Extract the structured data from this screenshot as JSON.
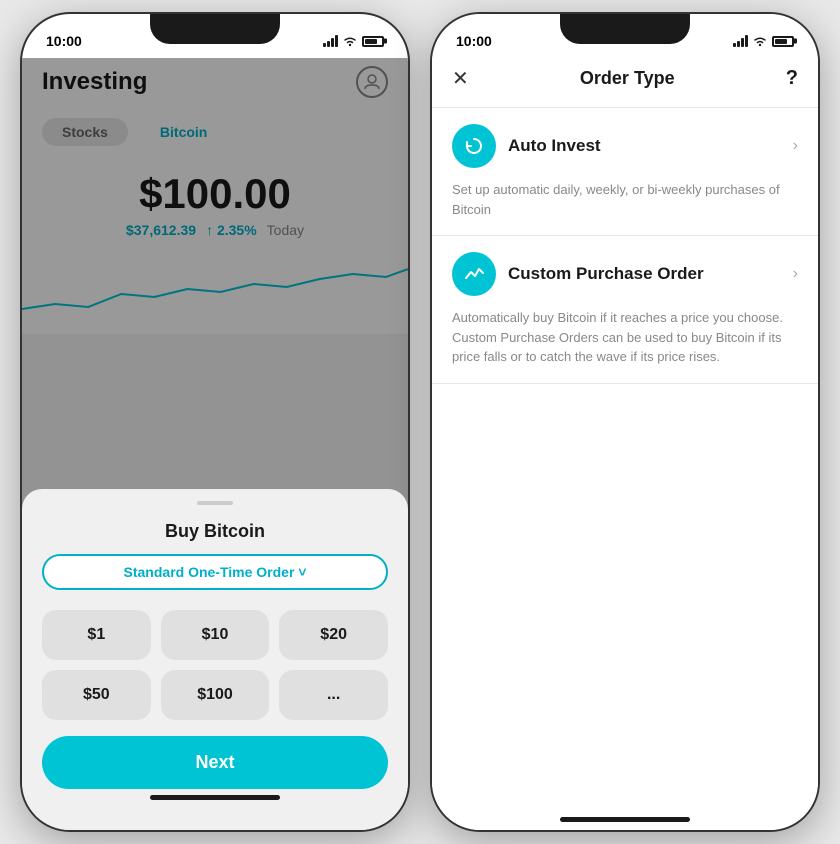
{
  "left_phone": {
    "status_bar": {
      "time": "10:00"
    },
    "header": {
      "title": "Investing",
      "profile_icon": "👤"
    },
    "tabs": [
      {
        "label": "Stocks",
        "active": false
      },
      {
        "label": "Bitcoin",
        "active": true
      }
    ],
    "price": {
      "main": "$100.00",
      "secondary": "$37,612.39",
      "change": "↑ 2.35%",
      "period": "Today"
    },
    "bottom_sheet": {
      "title": "Buy Bitcoin",
      "order_type": "Standard One-Time Order ˅",
      "amounts": [
        "$1",
        "$10",
        "$20",
        "$50",
        "$100",
        "..."
      ],
      "next_label": "Next"
    }
  },
  "right_phone": {
    "status_bar": {
      "time": "10:00"
    },
    "header": {
      "close_label": "✕",
      "title": "Order Type",
      "help_label": "?"
    },
    "options": [
      {
        "icon": "↺",
        "name": "Auto Invest",
        "description": "Set up automatic daily, weekly, or bi-weekly purchases of Bitcoin"
      },
      {
        "icon": "〽",
        "name": "Custom Purchase Order",
        "description": "Automatically buy Bitcoin if it reaches a price you choose. Custom Purchase Orders can be used to buy Bitcoin if its price falls or to catch the wave if its price rises."
      }
    ]
  }
}
